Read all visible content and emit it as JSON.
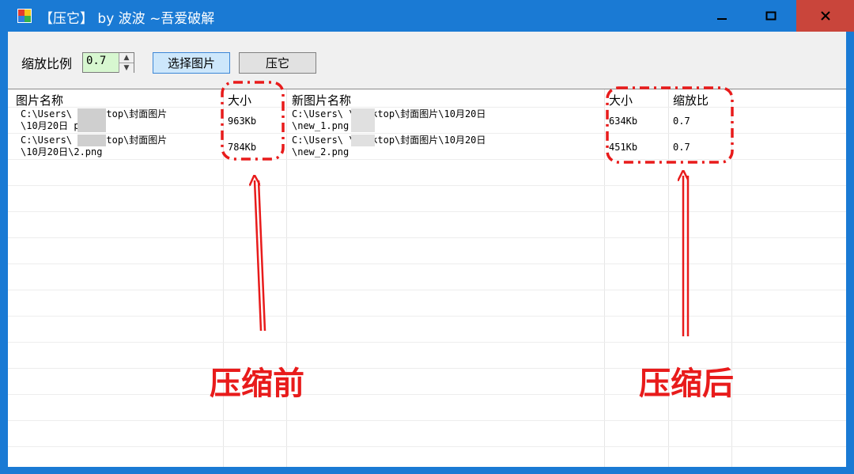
{
  "window": {
    "title": "【压它】 by 波波 ~吾爱破解",
    "controls": {
      "minimize": "▁",
      "maximize": "▢",
      "close": "✕"
    }
  },
  "toolbar": {
    "scale_label": "缩放比例",
    "scale_value": "0.7",
    "select_button": "选择图片",
    "compress_button": "压它"
  },
  "table": {
    "headers": {
      "name": "图片名称",
      "size": "大小",
      "new_name": "新图片名称",
      "new_size": "大小",
      "ratio": "缩放比"
    },
    "rows": [
      {
        "name_line1": "C:\\Users\\      \\Desktop\\封面图片",
        "name_line2": "\\10月20日      png",
        "size": "963Kb",
        "new_name_line1": "C:\\Users\\      \\Desktop\\封面图片\\10月20日",
        "new_name_line2": "\\new_1.png",
        "new_size": "634Kb",
        "ratio": "0.7"
      },
      {
        "name_line1": "C:\\Users\\      \\Desktop\\封面图片",
        "name_line2": "\\10月20日\\2.png",
        "size": "784Kb",
        "new_name_line1": "C:\\Users\\      \\Desktop\\封面图片\\10月20日",
        "new_name_line2": "\\new_2.png",
        "new_size": "451Kb",
        "ratio": "0.7"
      }
    ]
  },
  "annotations": {
    "before": "压缩前",
    "after": "压缩后",
    "color": "#e81b1b"
  },
  "colors": {
    "titlebar": "#1a7ad4",
    "close_button": "#c9453b",
    "spinner_bg": "#d7f7d0",
    "select_button_bg": "#cde7fb"
  }
}
